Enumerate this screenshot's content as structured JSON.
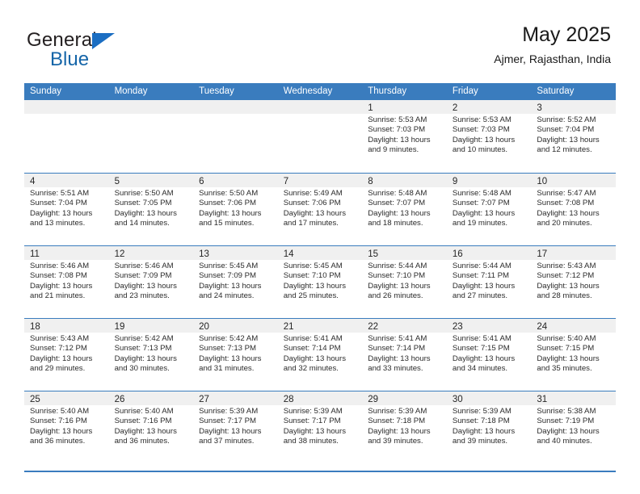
{
  "brand": {
    "word_one": "General",
    "word_two": "Blue",
    "logo_icon": "blue-triangle-icon"
  },
  "header": {
    "title": "May 2025",
    "subtitle": "Ajmer, Rajasthan, India"
  },
  "colors": {
    "header_blue": "#3a7cbe",
    "brand_blue": "#1565a8",
    "date_strip": "#f0f0f0",
    "text": "#1a1a1a"
  },
  "calendar": {
    "day_names": [
      "Sunday",
      "Monday",
      "Tuesday",
      "Wednesday",
      "Thursday",
      "Friday",
      "Saturday"
    ],
    "labels": {
      "sunrise": "Sunrise:",
      "sunset": "Sunset:",
      "daylight": "Daylight:"
    },
    "weeks": [
      [
        {
          "date": "",
          "empty": true
        },
        {
          "date": "",
          "empty": true
        },
        {
          "date": "",
          "empty": true
        },
        {
          "date": "",
          "empty": true
        },
        {
          "date": "1",
          "sunrise": "Sunrise: 5:53 AM",
          "sunset": "Sunset: 7:03 PM",
          "daylight_1": "Daylight: 13 hours",
          "daylight_2": "and 9 minutes."
        },
        {
          "date": "2",
          "sunrise": "Sunrise: 5:53 AM",
          "sunset": "Sunset: 7:03 PM",
          "daylight_1": "Daylight: 13 hours",
          "daylight_2": "and 10 minutes."
        },
        {
          "date": "3",
          "sunrise": "Sunrise: 5:52 AM",
          "sunset": "Sunset: 7:04 PM",
          "daylight_1": "Daylight: 13 hours",
          "daylight_2": "and 12 minutes."
        }
      ],
      [
        {
          "date": "4",
          "sunrise": "Sunrise: 5:51 AM",
          "sunset": "Sunset: 7:04 PM",
          "daylight_1": "Daylight: 13 hours",
          "daylight_2": "and 13 minutes."
        },
        {
          "date": "5",
          "sunrise": "Sunrise: 5:50 AM",
          "sunset": "Sunset: 7:05 PM",
          "daylight_1": "Daylight: 13 hours",
          "daylight_2": "and 14 minutes."
        },
        {
          "date": "6",
          "sunrise": "Sunrise: 5:50 AM",
          "sunset": "Sunset: 7:06 PM",
          "daylight_1": "Daylight: 13 hours",
          "daylight_2": "and 15 minutes."
        },
        {
          "date": "7",
          "sunrise": "Sunrise: 5:49 AM",
          "sunset": "Sunset: 7:06 PM",
          "daylight_1": "Daylight: 13 hours",
          "daylight_2": "and 17 minutes."
        },
        {
          "date": "8",
          "sunrise": "Sunrise: 5:48 AM",
          "sunset": "Sunset: 7:07 PM",
          "daylight_1": "Daylight: 13 hours",
          "daylight_2": "and 18 minutes."
        },
        {
          "date": "9",
          "sunrise": "Sunrise: 5:48 AM",
          "sunset": "Sunset: 7:07 PM",
          "daylight_1": "Daylight: 13 hours",
          "daylight_2": "and 19 minutes."
        },
        {
          "date": "10",
          "sunrise": "Sunrise: 5:47 AM",
          "sunset": "Sunset: 7:08 PM",
          "daylight_1": "Daylight: 13 hours",
          "daylight_2": "and 20 minutes."
        }
      ],
      [
        {
          "date": "11",
          "sunrise": "Sunrise: 5:46 AM",
          "sunset": "Sunset: 7:08 PM",
          "daylight_1": "Daylight: 13 hours",
          "daylight_2": "and 21 minutes."
        },
        {
          "date": "12",
          "sunrise": "Sunrise: 5:46 AM",
          "sunset": "Sunset: 7:09 PM",
          "daylight_1": "Daylight: 13 hours",
          "daylight_2": "and 23 minutes."
        },
        {
          "date": "13",
          "sunrise": "Sunrise: 5:45 AM",
          "sunset": "Sunset: 7:09 PM",
          "daylight_1": "Daylight: 13 hours",
          "daylight_2": "and 24 minutes."
        },
        {
          "date": "14",
          "sunrise": "Sunrise: 5:45 AM",
          "sunset": "Sunset: 7:10 PM",
          "daylight_1": "Daylight: 13 hours",
          "daylight_2": "and 25 minutes."
        },
        {
          "date": "15",
          "sunrise": "Sunrise: 5:44 AM",
          "sunset": "Sunset: 7:10 PM",
          "daylight_1": "Daylight: 13 hours",
          "daylight_2": "and 26 minutes."
        },
        {
          "date": "16",
          "sunrise": "Sunrise: 5:44 AM",
          "sunset": "Sunset: 7:11 PM",
          "daylight_1": "Daylight: 13 hours",
          "daylight_2": "and 27 minutes."
        },
        {
          "date": "17",
          "sunrise": "Sunrise: 5:43 AM",
          "sunset": "Sunset: 7:12 PM",
          "daylight_1": "Daylight: 13 hours",
          "daylight_2": "and 28 minutes."
        }
      ],
      [
        {
          "date": "18",
          "sunrise": "Sunrise: 5:43 AM",
          "sunset": "Sunset: 7:12 PM",
          "daylight_1": "Daylight: 13 hours",
          "daylight_2": "and 29 minutes."
        },
        {
          "date": "19",
          "sunrise": "Sunrise: 5:42 AM",
          "sunset": "Sunset: 7:13 PM",
          "daylight_1": "Daylight: 13 hours",
          "daylight_2": "and 30 minutes."
        },
        {
          "date": "20",
          "sunrise": "Sunrise: 5:42 AM",
          "sunset": "Sunset: 7:13 PM",
          "daylight_1": "Daylight: 13 hours",
          "daylight_2": "and 31 minutes."
        },
        {
          "date": "21",
          "sunrise": "Sunrise: 5:41 AM",
          "sunset": "Sunset: 7:14 PM",
          "daylight_1": "Daylight: 13 hours",
          "daylight_2": "and 32 minutes."
        },
        {
          "date": "22",
          "sunrise": "Sunrise: 5:41 AM",
          "sunset": "Sunset: 7:14 PM",
          "daylight_1": "Daylight: 13 hours",
          "daylight_2": "and 33 minutes."
        },
        {
          "date": "23",
          "sunrise": "Sunrise: 5:41 AM",
          "sunset": "Sunset: 7:15 PM",
          "daylight_1": "Daylight: 13 hours",
          "daylight_2": "and 34 minutes."
        },
        {
          "date": "24",
          "sunrise": "Sunrise: 5:40 AM",
          "sunset": "Sunset: 7:15 PM",
          "daylight_1": "Daylight: 13 hours",
          "daylight_2": "and 35 minutes."
        }
      ],
      [
        {
          "date": "25",
          "sunrise": "Sunrise: 5:40 AM",
          "sunset": "Sunset: 7:16 PM",
          "daylight_1": "Daylight: 13 hours",
          "daylight_2": "and 36 minutes."
        },
        {
          "date": "26",
          "sunrise": "Sunrise: 5:40 AM",
          "sunset": "Sunset: 7:16 PM",
          "daylight_1": "Daylight: 13 hours",
          "daylight_2": "and 36 minutes."
        },
        {
          "date": "27",
          "sunrise": "Sunrise: 5:39 AM",
          "sunset": "Sunset: 7:17 PM",
          "daylight_1": "Daylight: 13 hours",
          "daylight_2": "and 37 minutes."
        },
        {
          "date": "28",
          "sunrise": "Sunrise: 5:39 AM",
          "sunset": "Sunset: 7:17 PM",
          "daylight_1": "Daylight: 13 hours",
          "daylight_2": "and 38 minutes."
        },
        {
          "date": "29",
          "sunrise": "Sunrise: 5:39 AM",
          "sunset": "Sunset: 7:18 PM",
          "daylight_1": "Daylight: 13 hours",
          "daylight_2": "and 39 minutes."
        },
        {
          "date": "30",
          "sunrise": "Sunrise: 5:39 AM",
          "sunset": "Sunset: 7:18 PM",
          "daylight_1": "Daylight: 13 hours",
          "daylight_2": "and 39 minutes."
        },
        {
          "date": "31",
          "sunrise": "Sunrise: 5:38 AM",
          "sunset": "Sunset: 7:19 PM",
          "daylight_1": "Daylight: 13 hours",
          "daylight_2": "and 40 minutes."
        }
      ]
    ]
  }
}
